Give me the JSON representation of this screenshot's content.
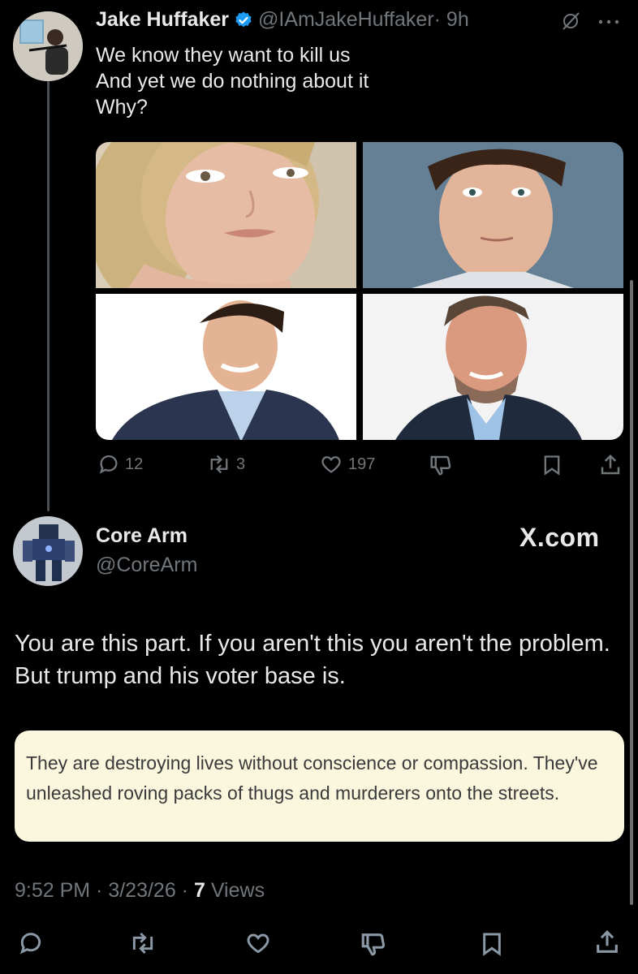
{
  "tweet": {
    "author_name": "Jake Huffaker",
    "author_handle": "@IAmJakeHuffaker",
    "time_ago": "· 9h",
    "lines": [
      "We know they want to kill us",
      "And yet we do nothing about it",
      "Why?"
    ],
    "actions": {
      "replies": "12",
      "reposts": "3",
      "likes": "197"
    }
  },
  "reply": {
    "author_name": "Core Arm",
    "author_handle": "@CoreArm",
    "site_label": "X.com",
    "text": "You are this part. If you aren't this you aren't the problem. But trump and his voter base is.",
    "quote": "They are destroying lives without conscience or compassion. They've unleashed roving packs of thugs and murderers onto the streets.",
    "timestamp": "9:52 PM · 3/23/26 ·",
    "views_count": "7",
    "views_label": "Views"
  },
  "icons": [
    "verified-badge-icon",
    "grok-icon",
    "more-icon",
    "reply-icon",
    "repost-icon",
    "like-icon",
    "dislike-icon",
    "bookmark-icon",
    "share-icon"
  ],
  "colors": {
    "background": "#000000",
    "text": "#e7e9ea",
    "muted": "#71767b",
    "verified": "#1d9bf0",
    "quote_bg": "#fbf7df"
  }
}
